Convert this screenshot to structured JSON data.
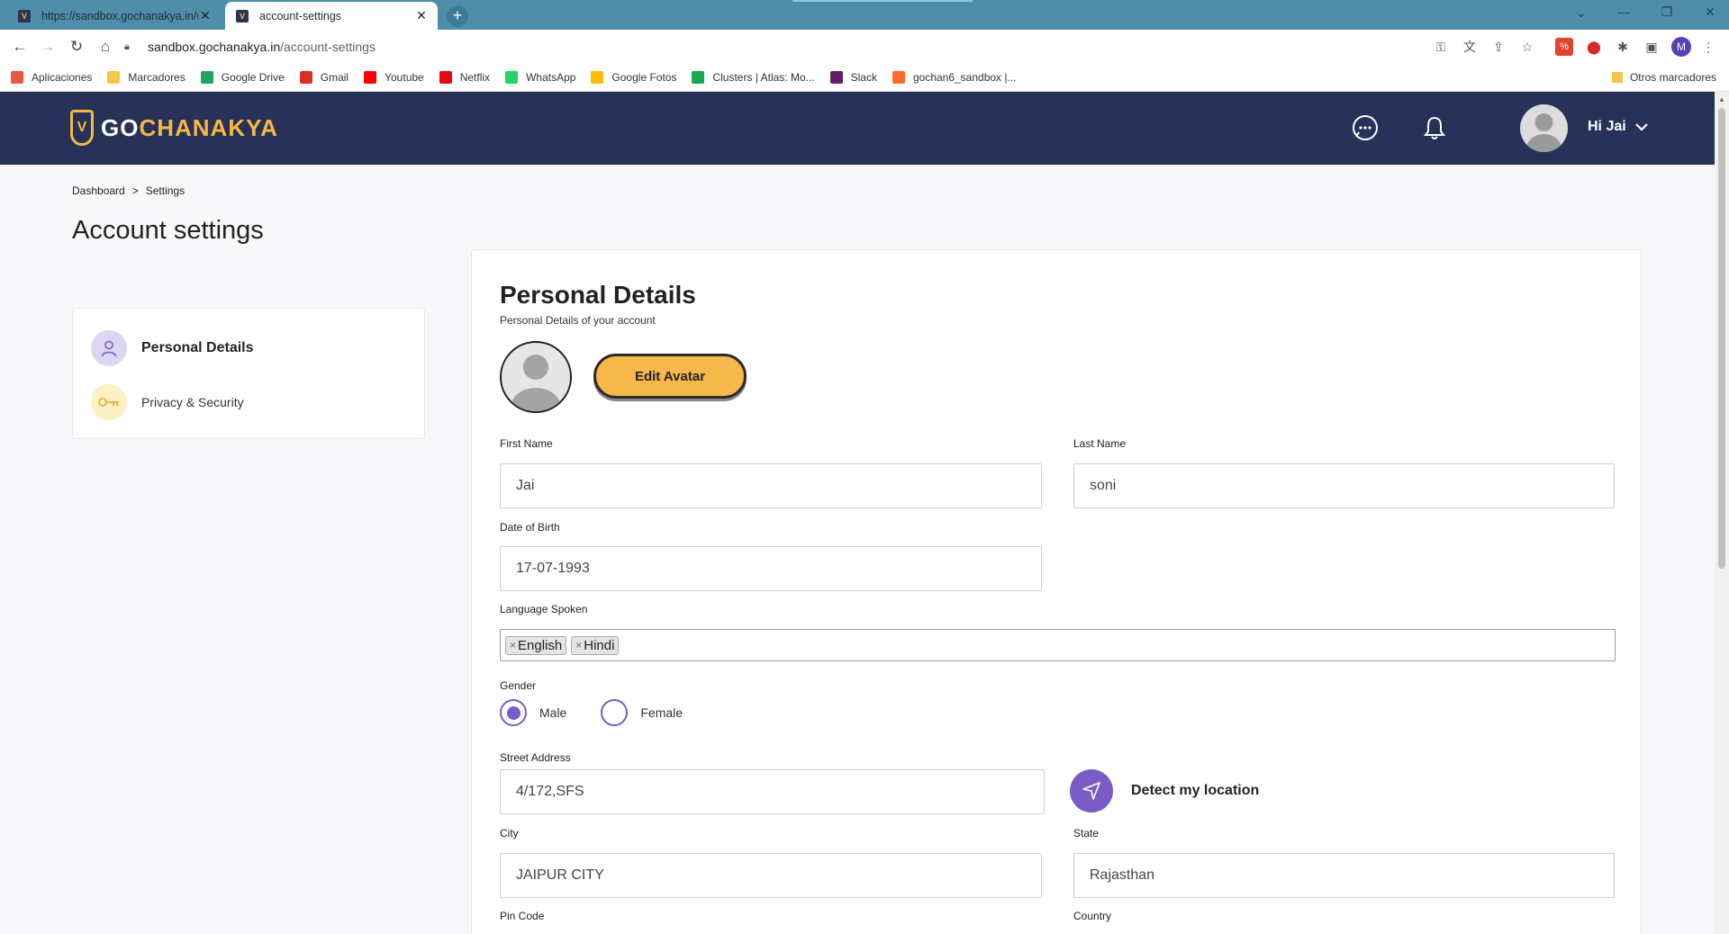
{
  "browser": {
    "tabs": [
      {
        "title": "https://sandbox.gochanakya.in/m",
        "active": false
      },
      {
        "title": "account-settings",
        "active": true
      }
    ],
    "url_host": "sandbox.gochanakya.in",
    "url_path": "/account-settings",
    "profile_initial": "M",
    "bookmarks": [
      {
        "label": "Aplicaciones",
        "icon": "apps-grid-icon",
        "color": "#e9573f"
      },
      {
        "label": "Marcadores",
        "icon": "folder-icon",
        "color": "#f6c64b"
      },
      {
        "label": "Google Drive",
        "icon": "google-drive-icon",
        "color": "#1fa463"
      },
      {
        "label": "Gmail",
        "icon": "gmail-icon",
        "color": "#d93025"
      },
      {
        "label": "Youtube",
        "icon": "youtube-icon",
        "color": "#ff0000"
      },
      {
        "label": "Netflix",
        "icon": "netflix-icon",
        "color": "#e50914"
      },
      {
        "label": "WhatsApp",
        "icon": "whatsapp-icon",
        "color": "#25d366"
      },
      {
        "label": "Google Fotos",
        "icon": "google-photos-icon",
        "color": "#fbbc04"
      },
      {
        "label": "Clusters | Atlas: Mo...",
        "icon": "mongodb-leaf-icon",
        "color": "#13aa52"
      },
      {
        "label": "Slack",
        "icon": "slack-icon",
        "color": "#611f69"
      },
      {
        "label": "gochan6_sandbox |...",
        "icon": "cpanel-icon",
        "color": "#ff6c2c"
      }
    ],
    "other_bookmarks": "Otros marcadores"
  },
  "header": {
    "brand_go": "GO",
    "brand_rest": "CHANAKYA",
    "greeting": "Hi Jai",
    "colors": {
      "bar": "#283157",
      "accent": "#f5b942"
    }
  },
  "page": {
    "breadcrumb": [
      "Dashboard",
      ">",
      "Settings"
    ],
    "title": "Account settings"
  },
  "sidebar": {
    "items": [
      {
        "label": "Personal Details",
        "icon": "user-icon",
        "active": true
      },
      {
        "label": "Privacy & Security",
        "icon": "key-icon",
        "active": false
      }
    ]
  },
  "form": {
    "title": "Personal Details",
    "subtitle": "Personal Details of your account",
    "edit_avatar": "Edit Avatar",
    "first_name": {
      "label": "First Name",
      "value": "Jai"
    },
    "last_name": {
      "label": "Last Name",
      "value": "soni"
    },
    "dob": {
      "label": "Date of Birth",
      "value": "17-07-1993"
    },
    "languages": {
      "label": "Language Spoken",
      "tags": [
        "English",
        "Hindi"
      ],
      "remove_glyph": "×"
    },
    "gender": {
      "label": "Gender",
      "options": [
        "Male",
        "Female"
      ],
      "selected": "Male"
    },
    "street": {
      "label": "Street Address",
      "value": "4/172,SFS"
    },
    "detect_location": "Detect my location",
    "city": {
      "label": "City",
      "value": "JAIPUR CITY"
    },
    "state": {
      "label": "State",
      "value": "Rajasthan"
    },
    "pin": {
      "label": "Pin Code"
    },
    "country": {
      "label": "Country"
    },
    "accent_color": "#7a5cc7",
    "button_color": "#f7b84b"
  }
}
